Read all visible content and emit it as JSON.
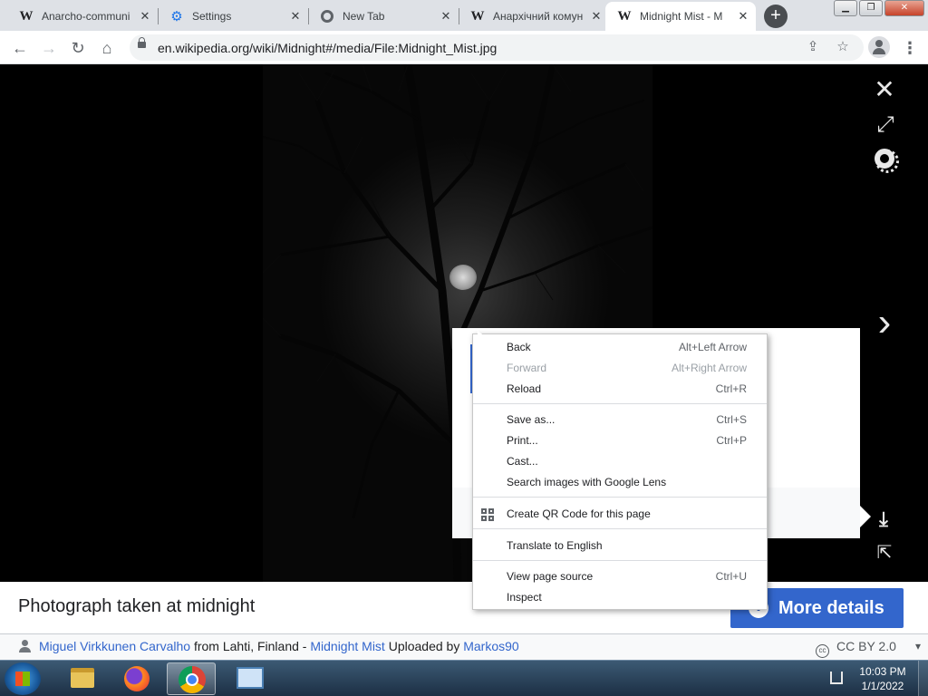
{
  "browser": {
    "tabs": [
      {
        "label": "Anarcho-communi",
        "favicon": "wikipedia-icon"
      },
      {
        "label": "Settings",
        "favicon": "gear-icon"
      },
      {
        "label": "New Tab",
        "favicon": "chrome-icon"
      },
      {
        "label": "Анархічний комун",
        "favicon": "wikipedia-icon"
      },
      {
        "label": "Midnight Mist - M",
        "favicon": "wikipedia-icon",
        "active": true
      }
    ],
    "url": "en.wikipedia.org/wiki/Midnight#/media/File:Midnight_Mist.jpg"
  },
  "context_menu": {
    "items": [
      {
        "label": "Back",
        "shortcut": "Alt+Left Arrow"
      },
      {
        "label": "Forward",
        "shortcut": "Alt+Right Arrow",
        "disabled": true
      },
      {
        "label": "Reload",
        "shortcut": "Ctrl+R"
      },
      {
        "label": "Save as...",
        "shortcut": "Ctrl+S"
      },
      {
        "label": "Print...",
        "shortcut": "Ctrl+P"
      },
      {
        "label": "Cast...",
        "shortcut": ""
      },
      {
        "label": "Search images with Google Lens",
        "shortcut": ""
      },
      {
        "label": "Create QR Code for this page",
        "shortcut": "",
        "icon": "qr-code-icon"
      },
      {
        "label": "Translate to English",
        "shortcut": ""
      },
      {
        "label": "View page source",
        "shortcut": "Ctrl+U"
      },
      {
        "label": "Inspect",
        "shortcut": ""
      }
    ]
  },
  "media": {
    "caption": "Photograph taken at midnight",
    "more_details": "More details",
    "author": "Miguel Virkkunen Carvalho",
    "from_text": "from Lahti, Finland -",
    "title_link": "Midnight Mist",
    "uploaded_text": "Uploaded by",
    "uploader": "Markos90",
    "license": "CC BY 2.0"
  },
  "taskbar": {
    "time": "10:03 PM",
    "date": "1/1/2022"
  },
  "colors": {
    "accent": "#3366cc",
    "tab_strip": "#dee1e6"
  }
}
